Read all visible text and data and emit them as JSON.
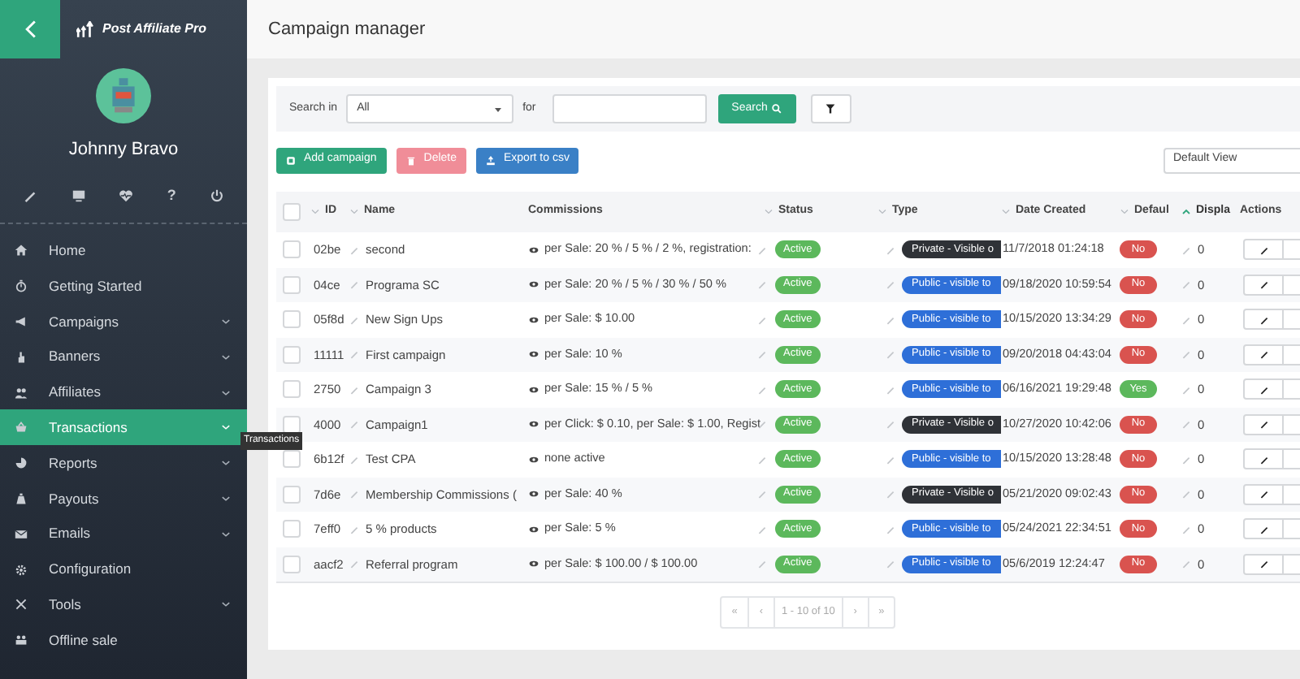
{
  "sidebar": {
    "logo": "Post Affiliate Pro",
    "user_name": "Johnny Bravo",
    "help": "?",
    "menu": [
      {
        "label": "Home",
        "expandable": false,
        "selected": false
      },
      {
        "label": "Getting Started",
        "expandable": false,
        "selected": false
      },
      {
        "label": "Campaigns",
        "expandable": true,
        "selected": false
      },
      {
        "label": "Banners",
        "expandable": true,
        "selected": false
      },
      {
        "label": "Affiliates",
        "expandable": true,
        "selected": false
      },
      {
        "label": "Transactions",
        "expandable": true,
        "selected": true
      },
      {
        "label": "Reports",
        "expandable": true,
        "selected": false
      },
      {
        "label": "Payouts",
        "expandable": true,
        "selected": false
      },
      {
        "label": "Emails",
        "expandable": true,
        "selected": false
      },
      {
        "label": "Configuration",
        "expandable": false,
        "selected": false
      },
      {
        "label": "Tools",
        "expandable": true,
        "selected": false
      },
      {
        "label": "Offline sale",
        "expandable": false,
        "selected": false
      }
    ]
  },
  "tooltip": "Transactions",
  "page_title": "Campaign manager",
  "search": {
    "label": "Search in",
    "scope": "All",
    "for_label": "for",
    "button": "Search"
  },
  "actions": [
    {
      "label": "Add campaign",
      "kind": "add"
    },
    {
      "label": "Delete",
      "kind": "delete"
    },
    {
      "label": "Export to csv",
      "kind": "export"
    }
  ],
  "view_select": "Default View",
  "table": {
    "all_checked": false,
    "columns": [
      {
        "label": "ID",
        "sortable": true,
        "sorted": false
      },
      {
        "label": "Name",
        "sortable": true,
        "sorted": false
      },
      {
        "label": "Commissions",
        "sortable": false,
        "sorted": false
      },
      {
        "label": "Status",
        "sortable": true,
        "sorted": false
      },
      {
        "label": "Type",
        "sortable": true,
        "sorted": false
      },
      {
        "label": "Date Created",
        "sortable": true,
        "sorted": false
      },
      {
        "label": "Defaul",
        "sortable": true,
        "sorted": false
      },
      {
        "label": "Displa",
        "sortable": true,
        "sorted": true
      },
      {
        "label": "Actions",
        "sortable": false,
        "sorted": false
      }
    ],
    "rows": [
      {
        "checked": false,
        "id": "02be",
        "name": "second",
        "commissions": "per Sale: 20 % / 5 % / 2 %, registration:",
        "status": "Active",
        "active": true,
        "type": "Private - Visible o",
        "private": true,
        "date": "11/7/2018 01:24:18",
        "default": "No",
        "is_default": false,
        "display": "0"
      },
      {
        "checked": false,
        "id": "04ce",
        "name": "Programa SC",
        "commissions": "per Sale: 20 % / 5 % / 30 % / 50 %",
        "status": "Active",
        "active": true,
        "type": "Public - visible to",
        "private": false,
        "date": "09/18/2020 10:59:54",
        "default": "No",
        "is_default": false,
        "display": "0"
      },
      {
        "checked": false,
        "id": "05f8d",
        "name": "New Sign Ups",
        "commissions": "per Sale: $ 10.00",
        "status": "Active",
        "active": true,
        "type": "Public - visible to",
        "private": false,
        "date": "10/15/2020 13:34:29",
        "default": "No",
        "is_default": false,
        "display": "0"
      },
      {
        "checked": false,
        "id": "11111",
        "name": "First campaign",
        "commissions": "per Sale: 10 %",
        "status": "Active",
        "active": true,
        "type": "Public - visible to",
        "private": false,
        "date": "09/20/2018 04:43:04",
        "default": "No",
        "is_default": false,
        "display": "0"
      },
      {
        "checked": false,
        "id": "2750",
        "name": "Campaign 3",
        "commissions": "per Sale: 15 % / 5 %",
        "status": "Active",
        "active": true,
        "type": "Public - visible to",
        "private": false,
        "date": "06/16/2021 19:29:48",
        "default": "Yes",
        "is_default": true,
        "display": "0"
      },
      {
        "checked": false,
        "id": "4000",
        "name": "Campaign1",
        "commissions": "per Click: $ 0.10, per Sale: $ 1.00, Regist",
        "status": "Active",
        "active": true,
        "type": "Private - Visible o",
        "private": true,
        "date": "10/27/2020 10:42:06",
        "default": "No",
        "is_default": false,
        "display": "0"
      },
      {
        "checked": false,
        "id": "6b12f",
        "name": "Test CPA",
        "commissions": "none active",
        "status": "Active",
        "active": true,
        "type": "Public - visible to",
        "private": false,
        "date": "10/15/2020 13:28:48",
        "default": "No",
        "is_default": false,
        "display": "0"
      },
      {
        "checked": false,
        "id": "7d6e",
        "name": "Membership Commissions (",
        "commissions": "per Sale: 40 %",
        "status": "Active",
        "active": true,
        "type": "Private - Visible o",
        "private": true,
        "date": "05/21/2020 09:02:43",
        "default": "No",
        "is_default": false,
        "display": "0"
      },
      {
        "checked": false,
        "id": "7eff0",
        "name": "5 % products",
        "commissions": "per Sale: 5 %",
        "status": "Active",
        "active": true,
        "type": "Public - visible to",
        "private": false,
        "date": "05/24/2021 22:34:51",
        "default": "No",
        "is_default": false,
        "display": "0"
      },
      {
        "checked": false,
        "id": "aacf2",
        "name": "Referral program",
        "commissions": "per Sale: $ 100.00 / $ 100.00",
        "status": "Active",
        "active": true,
        "type": "Public - visible to",
        "private": false,
        "date": "05/6/2019 12:24:47",
        "default": "No",
        "is_default": false,
        "display": "0"
      }
    ]
  },
  "pagination": {
    "first": "«",
    "prev": "‹",
    "summary": "1 - 10 of 10",
    "next": "›",
    "last": "»"
  }
}
